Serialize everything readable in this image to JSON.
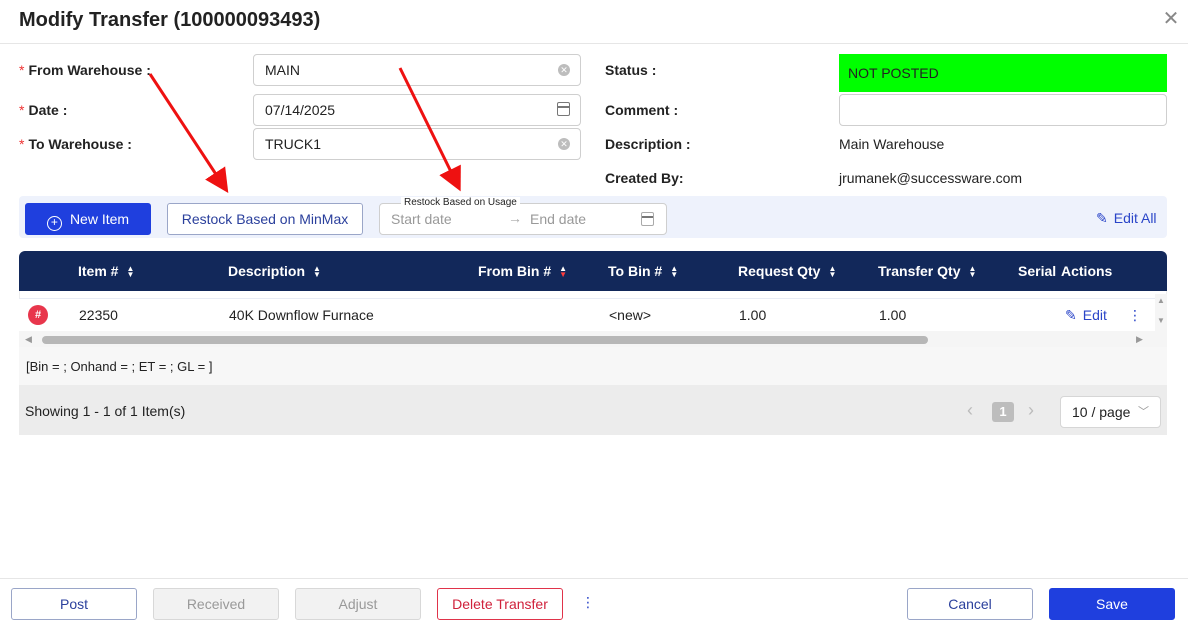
{
  "modal": {
    "title": "Modify Transfer (100000093493)"
  },
  "form": {
    "from_warehouse": {
      "label": "From Warehouse",
      "colon": ":",
      "value": "MAIN"
    },
    "date": {
      "label": "Date",
      "colon": ":",
      "value": "07/14/2025"
    },
    "to_warehouse": {
      "label": "To Warehouse",
      "colon": ":",
      "value": "TRUCK1"
    },
    "status": {
      "label": "Status",
      "colon": ":",
      "value": "NOT POSTED",
      "color": "#00ff00"
    },
    "comment": {
      "label": "Comment",
      "colon": ":",
      "value": ""
    },
    "description": {
      "label": "Description",
      "colon": ":",
      "value": "Main Warehouse"
    },
    "created_by": {
      "label": "Created By",
      "colon": ":",
      "value": "jrumanek@successware.com"
    }
  },
  "toolbar": {
    "new_item": "New Item",
    "restock_minmax": "Restock Based on MinMax",
    "restock_usage_label": "Restock Based on Usage",
    "start_date_placeholder": "Start date",
    "end_date_placeholder": "End date",
    "range_arrow": "→",
    "edit_all": "Edit All"
  },
  "table": {
    "columns": [
      "Item #",
      "Description",
      "From Bin #",
      "To Bin #",
      "Request Qty",
      "Transfer Qty",
      "Serial",
      "Actions"
    ],
    "rows": [
      {
        "badge": "#",
        "item": "22350",
        "description": "40K Downflow Furnace",
        "from_bin": "",
        "to_bin": "<new>",
        "request_qty": "1.00",
        "transfer_qty": "1.00",
        "serial": "",
        "edit": "Edit",
        "more": "⋮"
      }
    ],
    "row_info": "[Bin = ; Onhand = ; ET = ; GL = ]",
    "showing": "Showing 1 - 1 of 1 Item(s)",
    "page": "1",
    "page_size": "10 / page",
    "prev": "‹",
    "next": "›"
  },
  "footer": {
    "post": "Post",
    "received": "Received",
    "adjust": "Adjust",
    "delete": "Delete Transfer",
    "more": "⋮",
    "cancel": "Cancel",
    "save": "Save"
  },
  "colors": {
    "primary": "#1f3fde",
    "header": "#12285a",
    "danger": "#e8364c",
    "status": "#00ff00",
    "arrow": "#ee1111"
  }
}
